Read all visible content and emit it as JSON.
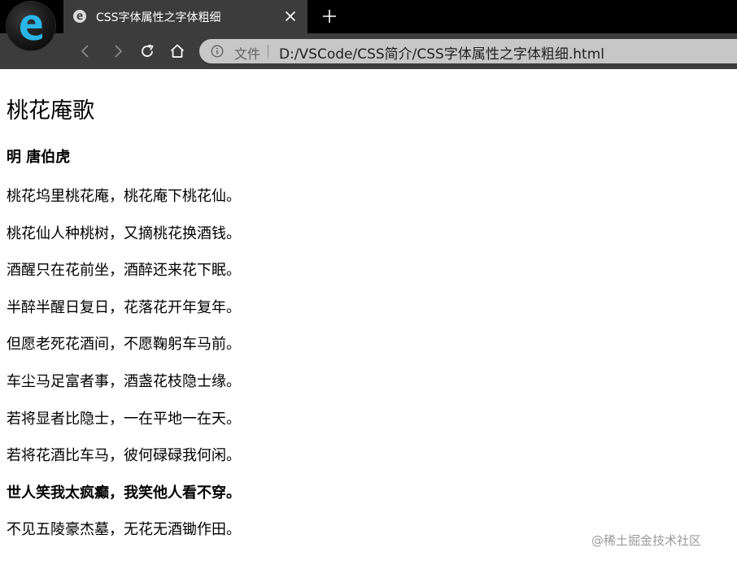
{
  "browser": {
    "tab": {
      "title": "CSS字体属性之字体粗细"
    },
    "address": {
      "file_label": "文件",
      "url": "D:/VSCode/CSS简介/CSS字体属性之字体粗细.html"
    },
    "icons": [
      "browser-logo",
      "edge-favicon",
      "close-icon",
      "plus-icon",
      "back-icon",
      "forward-icon",
      "refresh-icon",
      "home-icon",
      "info-icon"
    ]
  },
  "page": {
    "title": "桃花庵歌",
    "author": "明 唐伯虎",
    "lines": [
      "桃花坞里桃花庵，桃花庵下桃花仙。",
      "桃花仙人种桃树，又摘桃花换酒钱。",
      "酒醒只在花前坐，酒醉还来花下眠。",
      "半醉半醒日复日，花落花开年复年。",
      "但愿老死花酒间，不愿鞠躬车马前。",
      "车尘马足富者事，酒盏花枝隐士缘。",
      "若将显者比隐士，一在平地一在天。",
      "若将花酒比车马，彼何碌碌我何闲。",
      "世人笑我太疯癫，我笑他人看不穿。",
      "不见五陵豪杰墓，无花无酒锄作田。"
    ]
  },
  "watermark": "@稀土掘金技术社区"
}
